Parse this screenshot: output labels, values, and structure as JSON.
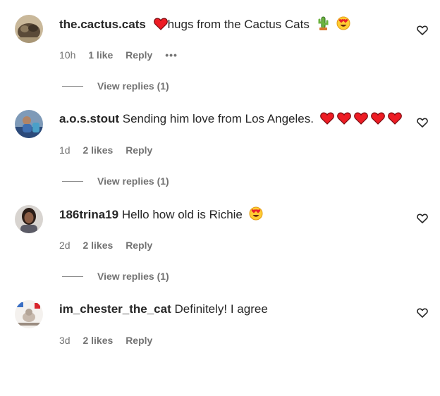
{
  "comments": [
    {
      "username": "the.cactus.cats",
      "text": "hugs from the Cactus Cats",
      "time": "10h",
      "likes": "1 like",
      "reply": "Reply",
      "more": "•••",
      "view_replies": "View replies (1)",
      "prefix_emoji": [
        "red-heart-emoji"
      ],
      "suffix_emoji": [
        "cactus-emoji",
        "heart-eyes-emoji"
      ]
    },
    {
      "username": "a.o.s.stout",
      "text": "Sending him love from Los Angeles.",
      "time": "1d",
      "likes": "2 likes",
      "reply": "Reply",
      "view_replies": "View replies (1)",
      "suffix_emoji": [
        "red-heart-emoji",
        "red-heart-emoji",
        "red-heart-emoji",
        "red-heart-emoji",
        "red-heart-emoji"
      ]
    },
    {
      "username": "186trina19",
      "text": "Hello how old is Richie",
      "time": "2d",
      "likes": "2 likes",
      "reply": "Reply",
      "view_replies": "View replies (1)",
      "suffix_emoji": [
        "heart-eyes-emoji"
      ]
    },
    {
      "username": "im_chester_the_cat",
      "text": "Definitely! I agree",
      "time": "3d",
      "likes": "2 likes",
      "reply": "Reply"
    }
  ],
  "colors": {
    "text": "#262626",
    "muted": "#737373",
    "heart_red": "#ED1C24"
  }
}
